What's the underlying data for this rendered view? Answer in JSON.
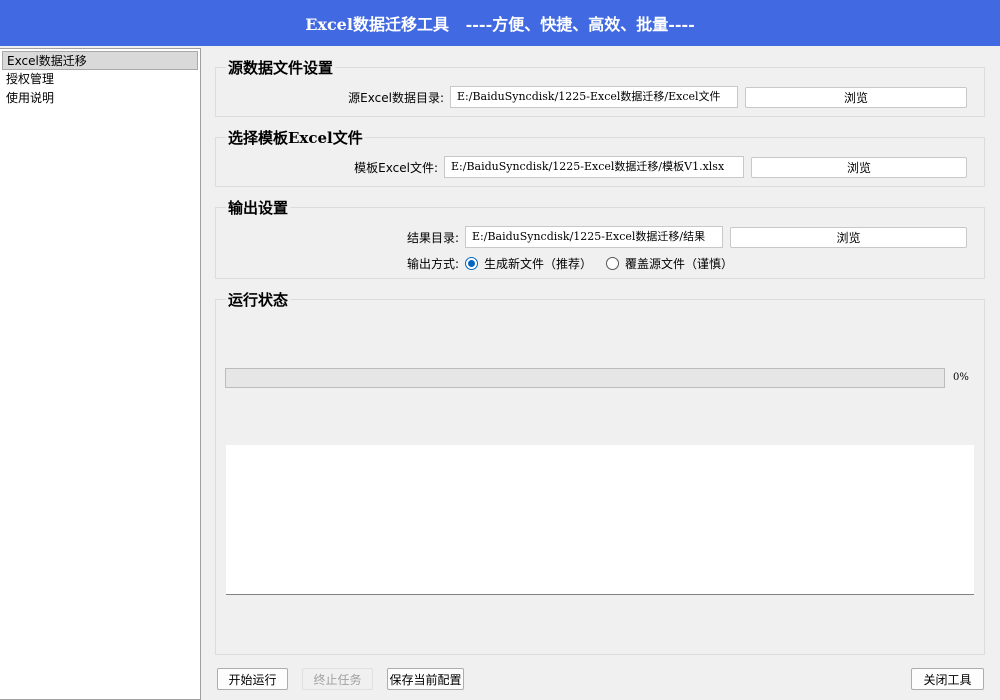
{
  "window": {
    "title": "Excel数据迁移工具   ----方便、快捷、高效、批量----"
  },
  "sidebar": {
    "items": [
      {
        "label": "Excel数据迁移",
        "selected": true
      },
      {
        "label": "授权管理",
        "selected": false
      },
      {
        "label": "使用说明",
        "selected": false
      }
    ]
  },
  "source": {
    "title": "源数据文件设置",
    "label": "源Excel数据目录:",
    "value": "E:/BaiduSyncdisk/1225-Excel数据迁移/Excel文件",
    "browse": "浏览"
  },
  "template": {
    "title": "选择模板Excel文件",
    "label": "模板Excel文件:",
    "value": "E:/BaiduSyncdisk/1225-Excel数据迁移/模板V1.xlsx",
    "browse": "浏览"
  },
  "output": {
    "title": "输出设置",
    "dir_label": "结果目录:",
    "dir_value": "E:/BaiduSyncdisk/1225-Excel数据迁移/结果",
    "browse": "浏览",
    "mode_label": "输出方式:",
    "mode_options": [
      {
        "label": "生成新文件（推荐）",
        "checked": true
      },
      {
        "label": "覆盖源文件（谨慎）",
        "checked": false
      }
    ]
  },
  "status": {
    "title": "运行状态",
    "progress": 0,
    "progress_text": "0%",
    "log": ""
  },
  "buttons": {
    "start": "开始运行",
    "stop": "终止任务",
    "save": "保存当前配置",
    "close": "关闭工具"
  },
  "colors": {
    "titlebar": "#4169e1",
    "radio_accent": "#0067c0"
  }
}
